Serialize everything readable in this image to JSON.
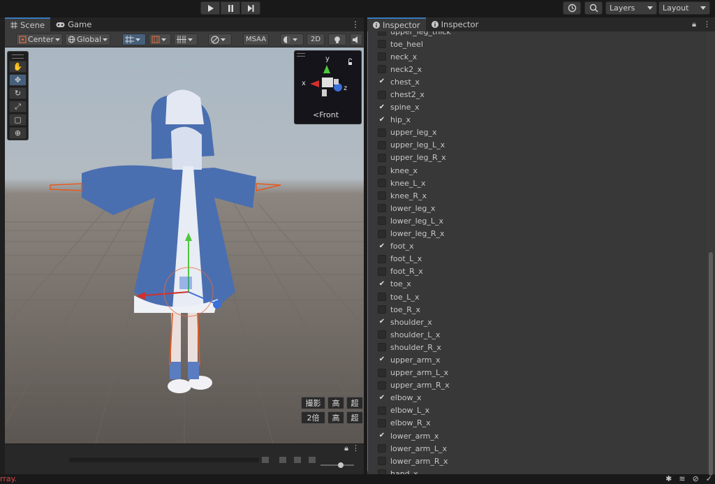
{
  "toolbar": {
    "play_icon": "play-icon",
    "pause_icon": "pause-icon",
    "step_icon": "step-icon",
    "history_icon": "history-icon",
    "search_icon": "search-icon",
    "layers_label": "Layers",
    "layout_label": "Layout"
  },
  "scene_panel": {
    "tabs": [
      {
        "label": "Scene",
        "icon": "grid-icon"
      },
      {
        "label": "Game",
        "icon": "gamepad-icon"
      }
    ],
    "toolbar": {
      "pivot_label": "Center",
      "space_label": "Global",
      "msaa_label": "MSAA",
      "mode_2d_label": "2D"
    },
    "gizmo": {
      "axis_x": "x",
      "axis_y": "y",
      "axis_z": "z",
      "view_label": "Front"
    },
    "overlay_buttons": [
      "撮影",
      "高",
      "超",
      "2倍",
      "高",
      "超"
    ]
  },
  "inspector": {
    "tabs": [
      {
        "label": "Inspector",
        "icon": "info-icon"
      },
      {
        "label": "Inspector",
        "icon": "info-icon"
      }
    ],
    "items": [
      {
        "label": "upper_leg_thick",
        "checked": false
      },
      {
        "label": "toe_heel",
        "checked": false
      },
      {
        "label": "neck_x",
        "checked": false
      },
      {
        "label": "neck2_x",
        "checked": false
      },
      {
        "label": "chest_x",
        "checked": true
      },
      {
        "label": "chest2_x",
        "checked": false
      },
      {
        "label": "spine_x",
        "checked": true
      },
      {
        "label": "hip_x",
        "checked": true
      },
      {
        "label": "upper_leg_x",
        "checked": false
      },
      {
        "label": "upper_leg_L_x",
        "checked": false
      },
      {
        "label": "upper_leg_R_x",
        "checked": false
      },
      {
        "label": "knee_x",
        "checked": false
      },
      {
        "label": "knee_L_x",
        "checked": false
      },
      {
        "label": "knee_R_x",
        "checked": false
      },
      {
        "label": "lower_leg_x",
        "checked": false
      },
      {
        "label": "lower_leg_L_x",
        "checked": false
      },
      {
        "label": "lower_leg_R_x",
        "checked": false
      },
      {
        "label": "foot_x",
        "checked": true
      },
      {
        "label": "foot_L_x",
        "checked": false
      },
      {
        "label": "foot_R_x",
        "checked": false
      },
      {
        "label": "toe_x",
        "checked": true
      },
      {
        "label": "toe_L_x",
        "checked": false
      },
      {
        "label": "toe_R_x",
        "checked": false
      },
      {
        "label": "shoulder_x",
        "checked": true
      },
      {
        "label": "shoulder_L_x",
        "checked": false
      },
      {
        "label": "shoulder_R_x",
        "checked": false
      },
      {
        "label": "upper_arm_x",
        "checked": true
      },
      {
        "label": "upper_arm_L_x",
        "checked": false
      },
      {
        "label": "upper_arm_R_x",
        "checked": false
      },
      {
        "label": "elbow_x",
        "checked": true
      },
      {
        "label": "elbow_L_x",
        "checked": false
      },
      {
        "label": "elbow_R_x",
        "checked": false
      },
      {
        "label": "lower_arm_x",
        "checked": true
      },
      {
        "label": "lower_arm_L_x",
        "checked": false
      },
      {
        "label": "lower_arm_R_x",
        "checked": false
      },
      {
        "label": "hand_x",
        "checked": false
      }
    ]
  },
  "status": {
    "error_text": "rray."
  },
  "colors": {
    "accent": "#3a79bb",
    "error": "#e04848",
    "axis_x": "#d03030",
    "axis_y": "#4cc83c",
    "axis_z": "#3a6fd8"
  }
}
